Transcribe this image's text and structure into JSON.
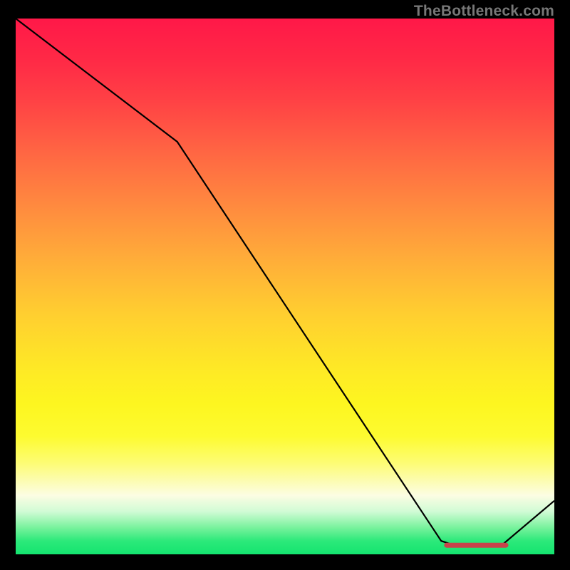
{
  "attribution": "TheBottleneck.com",
  "chart_data": {
    "type": "line",
    "title": "",
    "xlabel": "",
    "ylabel": "",
    "xlim": [
      0,
      100
    ],
    "ylim": [
      0,
      100
    ],
    "series": [
      {
        "name": "bottleneck-curve",
        "x": [
          0,
          30,
          79,
          82,
          90,
          100
        ],
        "values": [
          100,
          77,
          2.5,
          1.5,
          1.5,
          10
        ]
      }
    ],
    "markers": {
      "name": "optimal-range",
      "x": [
        80,
        91
      ],
      "values": [
        1.7,
        1.7
      ]
    },
    "background": "red-to-green-vertical-gradient"
  }
}
